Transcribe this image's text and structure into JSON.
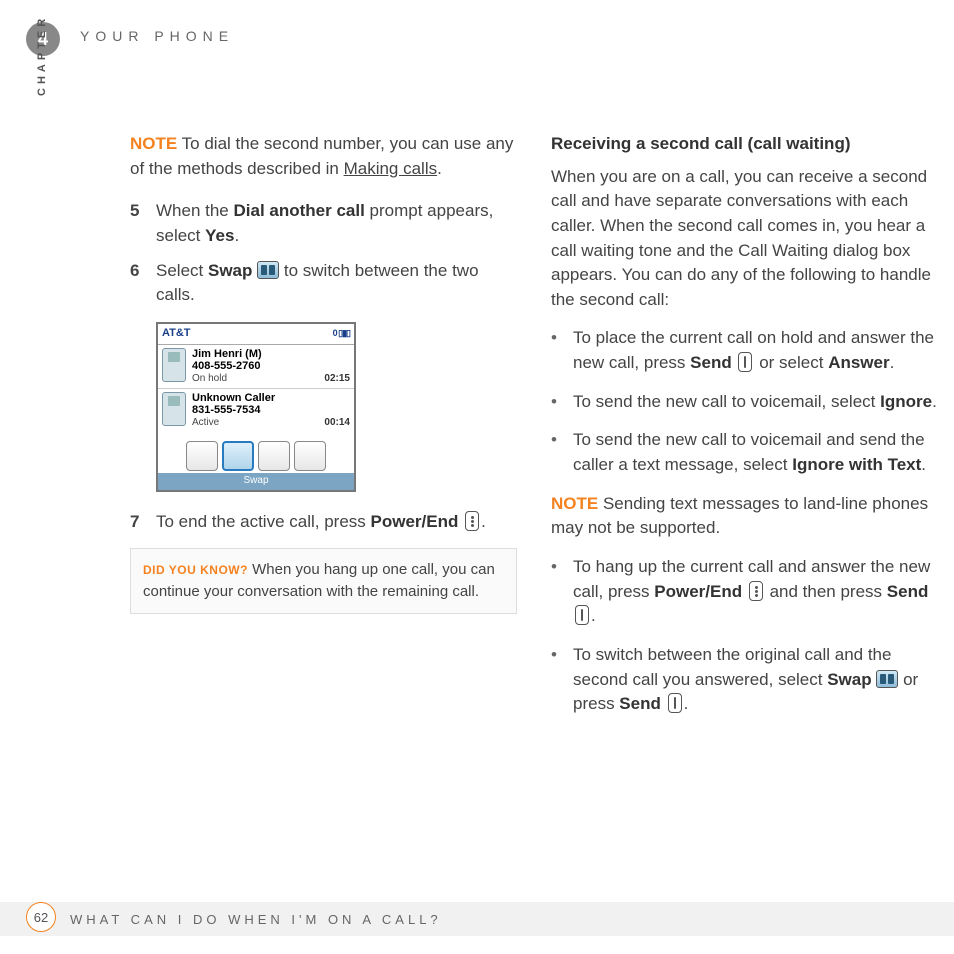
{
  "header": {
    "chapter_number": "4",
    "section_title": "YOUR PHONE",
    "side_label": "CHAPTER"
  },
  "left": {
    "note_label": "NOTE",
    "note_text_a": "To dial the second number, you can use any of the methods described in ",
    "note_link": "Making calls",
    "note_text_b": ".",
    "step5_num": "5",
    "step5_a": "When the ",
    "step5_b": "Dial another call",
    "step5_c": " prompt appears, select ",
    "step5_d": "Yes",
    "step5_e": ".",
    "step6_num": "6",
    "step6_a": "Select ",
    "step6_b": "Swap",
    "step6_c": " to switch between the two calls.",
    "screenshot": {
      "carrier": "AT&T",
      "signal": "0 ▯▮▯",
      "call1": {
        "name": "Jim Henri (M)",
        "number": "408-555-2760",
        "status": "On hold",
        "time": "02:15"
      },
      "call2": {
        "name": "Unknown Caller",
        "number": "831-555-7534",
        "status": "Active",
        "time": "00:14"
      },
      "selected_label": "Swap"
    },
    "step7_num": "7",
    "step7_a": "To end the active call, press ",
    "step7_b": "Power/End",
    "step7_c": ".",
    "dyk_label": "DID YOU KNOW?",
    "dyk_text": "When you hang up one call, you can continue your conversation with the remaining call."
  },
  "right": {
    "heading": "Receiving a second call (call waiting)",
    "intro": "When you are on a call, you can receive a second call and have separate conversations with each caller. When the second call comes in, you hear a call waiting tone and the Call Waiting dialog box appears. You can do any of the following to handle the second call:",
    "b1_a": "To place the current call on hold and answer the new call, press ",
    "b1_b": "Send",
    "b1_c": " or select ",
    "b1_d": "Answer",
    "b1_e": ".",
    "b2_a": "To send the new call to voicemail, select ",
    "b2_b": "Ignore",
    "b2_c": ".",
    "b3_a": "To send the new call to voicemail and send the caller a text message, select ",
    "b3_b": "Ignore with Text",
    "b3_c": ".",
    "note_label": "NOTE",
    "note_text": "Sending text messages to land-line phones may not be supported.",
    "b4_a": "To hang up the current call and answer the new call, press ",
    "b4_b": "Power/End",
    "b4_c": " and then press ",
    "b4_d": "Send",
    "b4_e": ".",
    "b5_a": "To switch between the original call and the second call you answered, select ",
    "b5_b": "Swap",
    "b5_c": " or press ",
    "b5_d": "Send",
    "b5_e": "."
  },
  "footer": {
    "page_number": "62",
    "text": "WHAT CAN I DO WHEN I'M ON A CALL?"
  }
}
